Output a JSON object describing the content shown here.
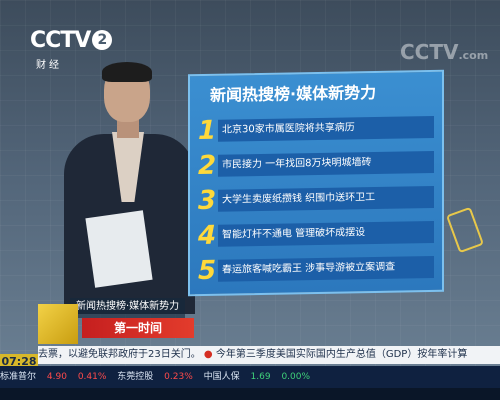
{
  "channel": {
    "logo": "CCTV",
    "number": "2",
    "sub": "财经"
  },
  "wall_logo": {
    "mark": "CCTV",
    "suffix": ".com"
  },
  "board": {
    "title": "新闻热搜榜·媒体新势力",
    "items": [
      {
        "n": "1",
        "text": "北京30家市属医院将共享病历"
      },
      {
        "n": "2",
        "text": "市民接力  一年找回8万块明城墙砖"
      },
      {
        "n": "3",
        "text": "大学生卖废纸攒钱  织围巾送环卫工"
      },
      {
        "n": "4",
        "text": "智能灯杆不通电  管理破坏成摆设"
      },
      {
        "n": "5",
        "text": "春运旅客喊吃霸王  涉事导游被立案调查"
      }
    ]
  },
  "lower": {
    "slug": "新闻热搜榜·媒体新势力",
    "show": "第一时间",
    "clock": "07:28"
  },
  "ticker": {
    "text": "去票，以避免联邦政府于23日关门。",
    "bullet": "●",
    "text2": "今年第三季度美国实际国内生产总值（GDP）按年率计算"
  },
  "stocks": [
    {
      "name": "标准普尔",
      "value": "",
      "chg": ""
    },
    {
      "name": "",
      "value": "4.90",
      "chg": "0.41%",
      "dir": "up"
    },
    {
      "name": "东莞控股",
      "value": "",
      "chg": "0.23%",
      "dir": "up"
    },
    {
      "name": "中国人保",
      "value": "1.69",
      "chg": "0.00%",
      "dir": "down"
    }
  ]
}
